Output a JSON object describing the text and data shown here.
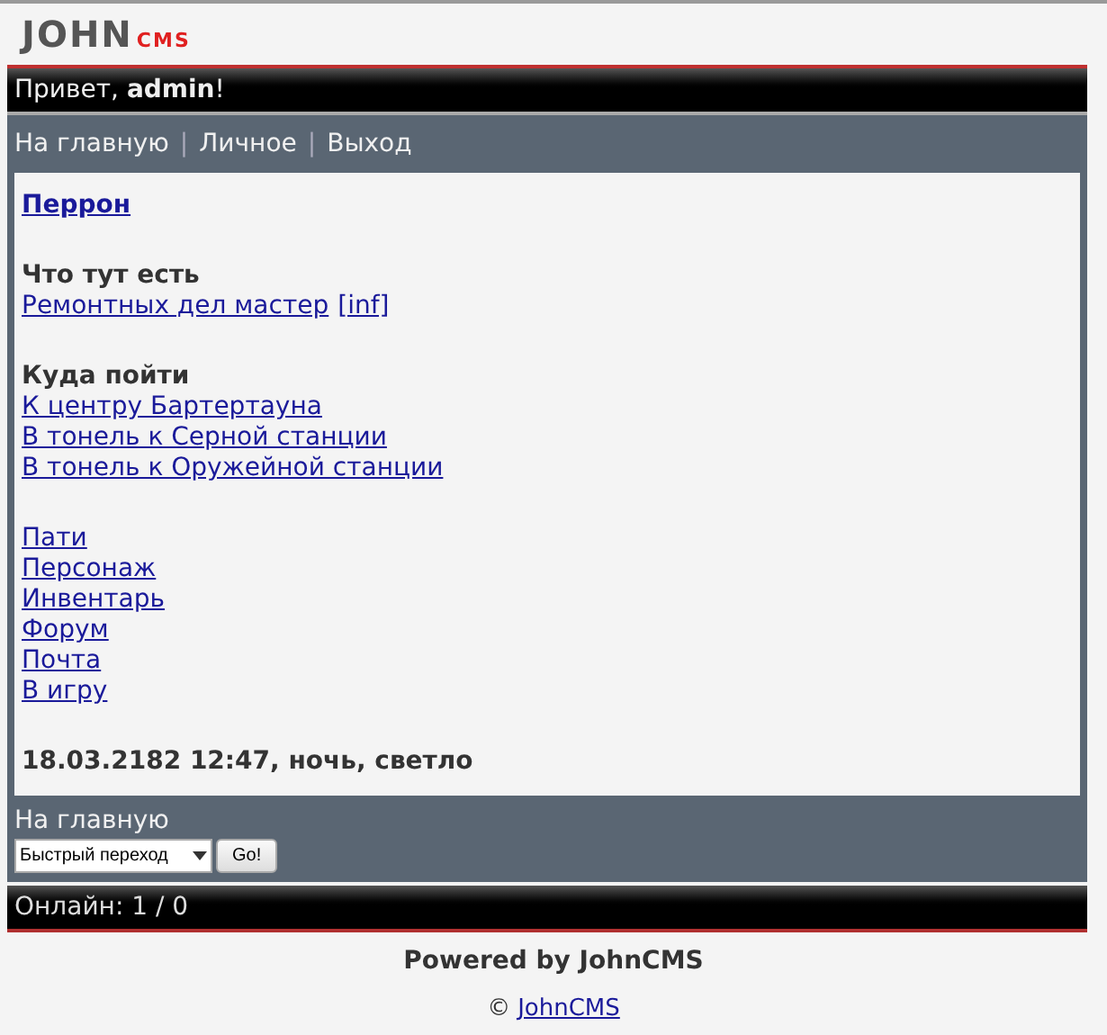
{
  "logo": {
    "main": "JOHN",
    "accent": "CMS"
  },
  "greeting": "Привет, **admin**!",
  "nav": {
    "separator": "|",
    "links": [
      "На главную",
      "Личное",
      "Выход"
    ]
  },
  "content": {
    "title": "Перрон",
    "sections": [
      {
        "heading": "Что тут есть",
        "items": [
          {
            "label": "Ремонтных дел мастер",
            "extra": "[inf]"
          }
        ]
      },
      {
        "heading": "Куда пойти",
        "items": [
          {
            "label": "К центру Бартертауна"
          },
          {
            "label": "В тонель к Серной станции"
          },
          {
            "label": "В тонель к Оружейной станции"
          }
        ]
      },
      {
        "items": [
          {
            "label": "Пати"
          },
          {
            "label": "Персонаж"
          },
          {
            "label": "Инвентарь"
          },
          {
            "label": "Форум"
          },
          {
            "label": "Почта"
          },
          {
            "label": "В игру"
          }
        ]
      }
    ],
    "status": "18.03.2182 12:47, ночь, светло"
  },
  "footer_nav": {
    "home": "На главную",
    "quick_jump": {
      "value": "Быстрый переход"
    },
    "go_button": "Go!"
  },
  "online": "Онлайн: 1 / 0",
  "powered_by": "Powered by JohnCMS",
  "copyright": {
    "symbol": "©",
    "link": "JohnCMS"
  }
}
